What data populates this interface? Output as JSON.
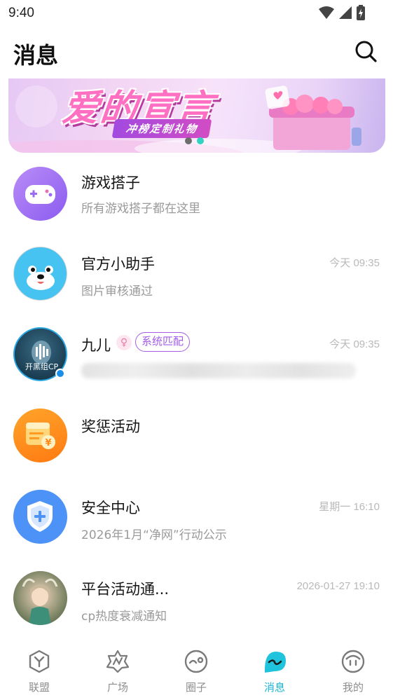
{
  "status_bar": {
    "time": "9:40"
  },
  "header": {
    "title": "消息",
    "search_icon": "search-icon"
  },
  "banner": {
    "title": "爱的宣言",
    "subtitle": "冲榜定制礼物",
    "dots": 2,
    "active_dot": 1
  },
  "messages": [
    {
      "name": "游戏搭子",
      "preview": "所有游戏搭子都在这里",
      "time": "",
      "avatar": "gamepad-avatar"
    },
    {
      "name": "官方小助手",
      "preview": "图片审核通过",
      "time": "今天 09:35",
      "avatar": "seal-mascot-avatar"
    },
    {
      "name": "九儿",
      "preview": "",
      "time": "今天 09:35",
      "tag": "系统匹配",
      "gender": "♀",
      "avatar_label": "开黑组CP",
      "avatar": "user-photo-avatar"
    },
    {
      "name": "奖惩活动",
      "preview": "",
      "time": "",
      "avatar": "reward-avatar"
    },
    {
      "name": "安全中心",
      "preview": "2026年1月“净网”行动公示",
      "time": "星期一 16:10",
      "avatar": "shield-avatar"
    },
    {
      "name": "平台活动通...",
      "preview": "cp热度衰减通知",
      "time": "2026-01-27 19:10",
      "avatar": "character-avatar"
    }
  ],
  "bottom_nav": [
    {
      "label": "联盟",
      "icon": "alliance-icon",
      "active": false
    },
    {
      "label": "广场",
      "icon": "plaza-icon",
      "active": false
    },
    {
      "label": "圈子",
      "icon": "circle-icon",
      "active": false
    },
    {
      "label": "消息",
      "icon": "message-icon",
      "active": true
    },
    {
      "label": "我的",
      "icon": "profile-icon",
      "active": false
    }
  ],
  "colors": {
    "accent": "#19b6d4",
    "tag": "#a35de6",
    "banner_title": "#ff6fc2"
  }
}
